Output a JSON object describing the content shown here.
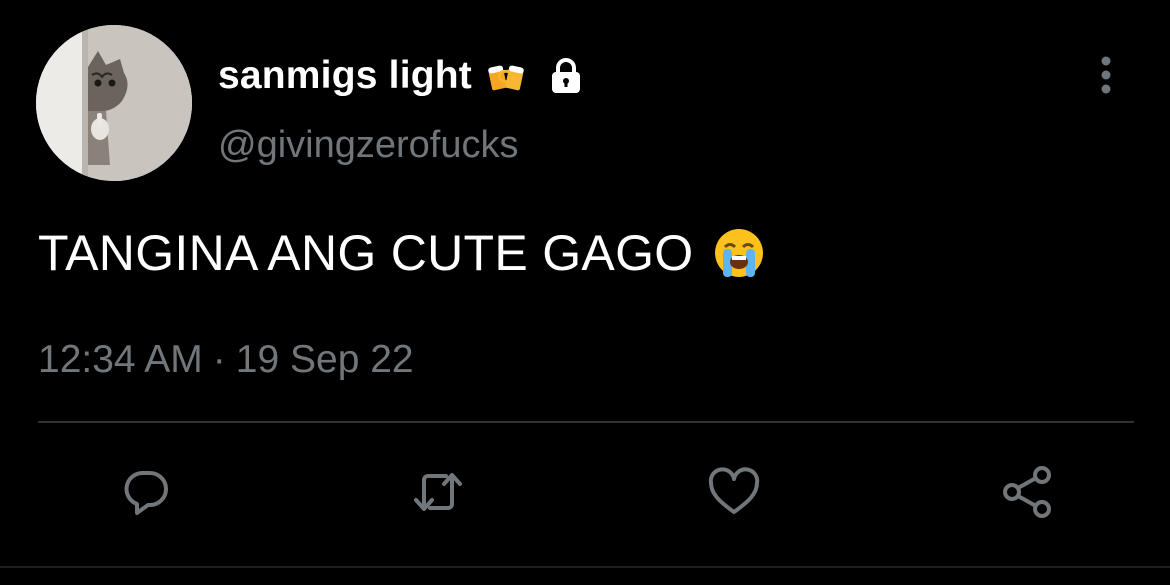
{
  "tweet": {
    "display_name": "sanmigs light",
    "handle": "@givingzerofucks",
    "text": "TANGINA ANG CUTE GAGO",
    "time": "12:34 AM",
    "separator": "·",
    "date": "19 Sep 22"
  },
  "icons": {
    "name_emoji": "beer-mugs-icon",
    "protected": "lock-icon",
    "text_emoji": "loudly-crying-face-icon",
    "more": "more-vertical-icon",
    "actions": [
      "reply-icon",
      "retweet-icon",
      "like-icon",
      "share-icon"
    ]
  },
  "colors": {
    "background": "#000000",
    "primary_text": "#ffffff",
    "secondary_text": "#71767b",
    "divider": "#2f3336"
  }
}
